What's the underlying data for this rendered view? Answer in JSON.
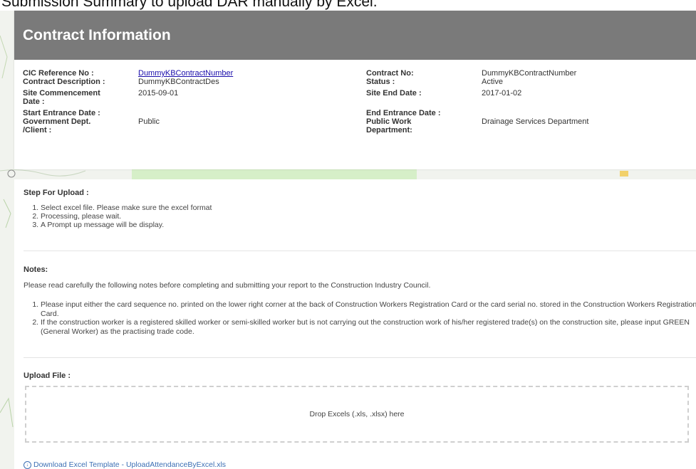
{
  "caption": "Submission Summary to upload DAR manually by Excel.",
  "contract": {
    "title": "Contract Information",
    "cic_ref_label": "CIC Reference No :",
    "cic_ref_value": "DummyKBContractNumber",
    "contract_desc_label": "Contract Description :",
    "contract_desc_value": "DummyKBContractDes",
    "site_commence_label_1": "Site Commencement",
    "site_commence_label_2": "Date :",
    "site_commence_value": "2015-09-01",
    "start_entrance_label": "Start Entrance Date :",
    "gov_dept_label_1": "Government Dept.",
    "gov_dept_label_2": "/Client :",
    "gov_dept_value": "Public",
    "contract_no_label": "Contract No:",
    "contract_no_value": "DummyKBContractNumber",
    "status_label": "Status :",
    "status_value": "Active",
    "site_end_label": "Site End Date :",
    "site_end_value": "2017-01-02",
    "end_entrance_label": "End Entrance Date :",
    "public_work_label_1": "Public Work",
    "public_work_label_2": "Department:",
    "public_work_value": "Drainage Services Department"
  },
  "steps": {
    "title": "Step For Upload :",
    "items": [
      "Select excel file. Please make sure the excel format",
      "Processing, please wait.",
      "A Prompt up message will be display."
    ]
  },
  "notes": {
    "title": "Notes:",
    "intro": "Please read carefully the following notes before completing and submitting your report to the Construction Industry Council.",
    "items": [
      "Please input either the card sequence no. printed on the lower right corner at the back of Construction Workers Registration Card or the card serial no. stored in the Construction Workers Registration Card.",
      "If the construction worker is a registered skilled worker or semi-skilled worker but is not carrying out the construction work of his/her registered trade(s) on the construction site, please input GREEN (General Worker) as the practising trade code."
    ]
  },
  "upload": {
    "title": "Upload File :",
    "dropzone_text": "Drop Excels (.xls, .xlsx) here",
    "download_text": "Download Excel Template - UploadAttendanceByExcel.xls"
  },
  "icons": {
    "download": "download-circle-icon"
  }
}
